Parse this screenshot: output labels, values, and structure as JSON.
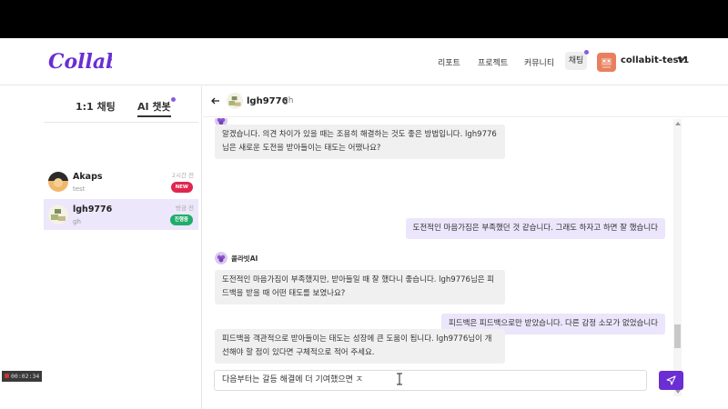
{
  "header": {
    "logo_text": "Collabit",
    "nav": [
      "리포트",
      "프로젝트",
      "커뮤니티"
    ],
    "chat_label": "채팅",
    "user_name": "collabit-test1",
    "accent": "#6a2ed3"
  },
  "tabs": {
    "direct": "1:1 채팅",
    "ai": "AI 챗봇"
  },
  "rooms": [
    {
      "name": "Akaps",
      "sub": "test",
      "time": "2시간 전",
      "badge": "NEW"
    },
    {
      "name": "lgh9776",
      "sub": "gh",
      "time": "방금 전",
      "badge": "진행중"
    }
  ],
  "chat": {
    "name": "lgh9776",
    "sub": "gh",
    "sender": "콜라빗AI",
    "messages": [
      {
        "role": "ai",
        "text": "알겠습니다. 의견 차이가 있을 때는 조용히 해결하는 것도 좋은 방법입니다. lgh9776님은 새로운 도전을 받아들이는 태도는 어땠나요?"
      },
      {
        "role": "user",
        "text": "도전적인 마음가짐은 부족했던 것 같습니다. 그래도 하자고 하면 잘 했습니다"
      },
      {
        "role": "ai",
        "text": "도전적인 마음가짐이 부족했지만, 받아들일 때 잘 했다니 좋습니다. lgh9776님은 피드백을 받을 때 어떤 태도를 보였나요?"
      },
      {
        "role": "user",
        "text": "피드백은 피드백으로만 받았습니다. 다른 감정 소모가 없었습니다"
      },
      {
        "role": "ai",
        "text": "피드백을 객관적으로 받아들이는 태도는 성장에 큰 도움이 됩니다. lgh9776님이 개선해야 할 점이 있다면 구체적으로 적어 주세요."
      }
    ],
    "input_value": "다음부터는 갈등 해결에 더 기여했으면 ㅈ"
  },
  "recorder": {
    "time": "00:02:34"
  },
  "icons": [
    "chevron-down-icon",
    "back-arrow-icon",
    "send-icon",
    "text-cursor-icon"
  ]
}
